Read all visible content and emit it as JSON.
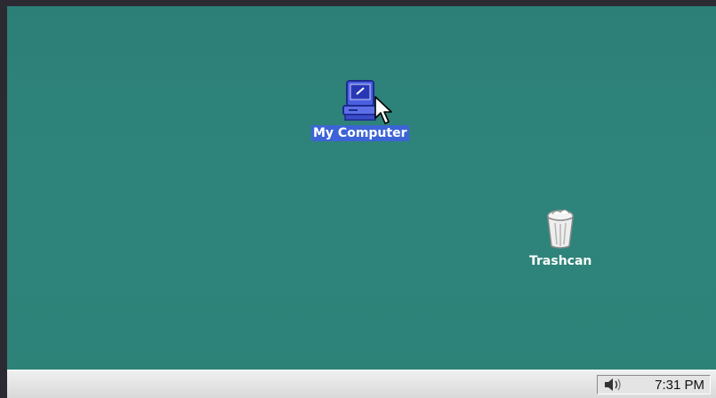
{
  "desktop": {
    "background_color": "#2d8278",
    "icons": [
      {
        "label": "My Computer",
        "icon": "computer-icon",
        "selected": true
      },
      {
        "label": "Trashcan",
        "icon": "trash-icon",
        "selected": false
      }
    ]
  },
  "taskbar": {
    "tray_icon": "volume-icon",
    "clock": "7:31 PM"
  },
  "colors": {
    "selection": "#3d64d6",
    "taskbar": "#dcdcdc"
  }
}
